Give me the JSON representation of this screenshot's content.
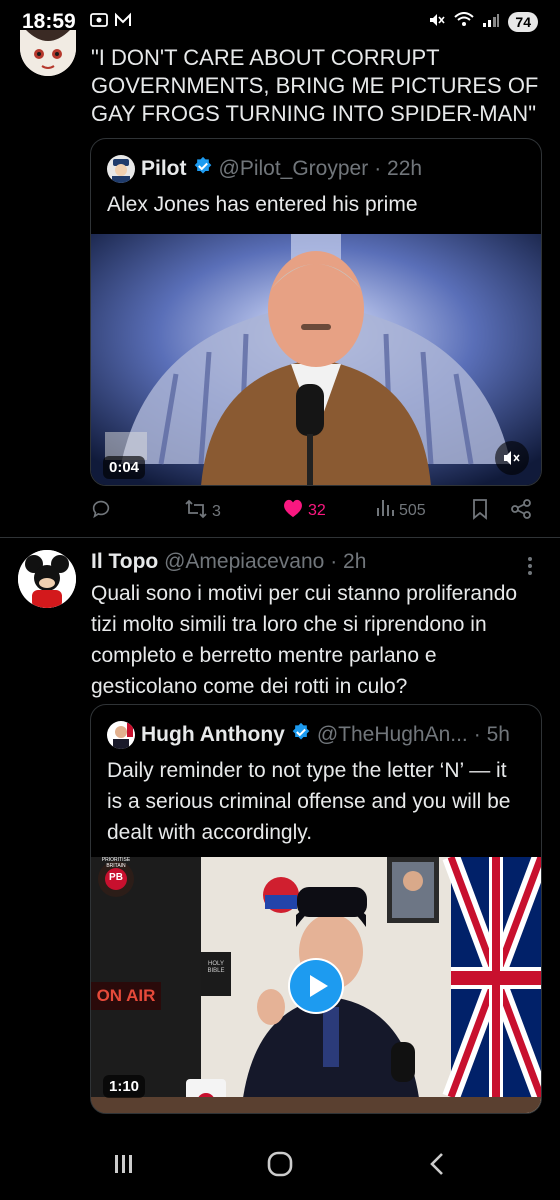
{
  "status_bar": {
    "time": "18:59",
    "battery": "74"
  },
  "tweet_top": {
    "text": "\"I DON'T CARE ABOUT CORRUPT GOVERNMENTS, BRING ME PICTURES OF GAY FROGS TURNING INTO SPIDER-MAN\""
  },
  "quote1": {
    "name": "Pilot",
    "handle": "@Pilot_Groyper",
    "time": "· 22h",
    "text": "Alex Jones has entered his prime",
    "video_duration": "0:04",
    "video_watermark": "INFO"
  },
  "actions1": {
    "retweets": "3",
    "likes": "32",
    "views": "505"
  },
  "tweet2": {
    "name": "Il Topo",
    "handle": "@Amepiacevano",
    "time": "· 2h",
    "text": "Quali sono i motivi per cui stanno proliferando tizi molto simili tra loro che si riprendono in completo e berretto mentre parlano e gesticolano come dei rotti in culo?"
  },
  "quote2": {
    "name": "Hugh Anthony",
    "handle": "@TheHughAn...",
    "time": "· 5h",
    "text": "Daily reminder to not type the letter ‘N’ — it is a serious criminal offense and you will be dealt with accordingly.",
    "video_duration": "1:10",
    "onair_sign": "ON AIR",
    "book_text": "HOLY BIBLE",
    "logo_text": "PB",
    "logo_ring": "PRIORITISE BRITAIN"
  },
  "colors": {
    "background": "#000000",
    "text": "#e7e9ea",
    "secondary": "#71767b",
    "like": "#f91880",
    "verified": "#1d9bf0",
    "border": "#2f3336"
  },
  "icons": [
    "reply-icon",
    "retweet-icon",
    "heart-icon",
    "views-icon",
    "bookmark-icon",
    "share-icon",
    "verified-icon",
    "more-icon",
    "mute-icon",
    "play-icon"
  ]
}
